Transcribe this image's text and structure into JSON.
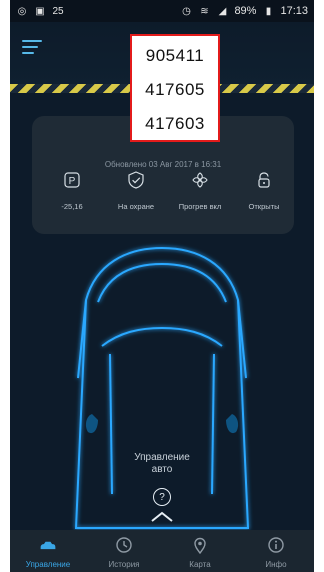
{
  "statusbar": {
    "left_icons": [
      "whatsapp-icon",
      "phone-icon",
      "25-icon"
    ],
    "battery": "89%",
    "time": "17:13"
  },
  "codes": [
    "905411",
    "417605",
    "417603"
  ],
  "card": {
    "updated": "Обновлено 03 Авг 2017 в 16:31",
    "stats": [
      {
        "label": "-25,16",
        "icon": "p-icon"
      },
      {
        "label": "На охране",
        "icon": "shield-check-icon"
      },
      {
        "label": "Прогрев вкл",
        "icon": "fan-icon"
      },
      {
        "label": "Открыты",
        "icon": "unlock-icon"
      }
    ]
  },
  "control": {
    "line1": "Управление",
    "line2": "авто"
  },
  "nav": [
    {
      "label": "Управление",
      "icon": "car-icon",
      "active": true
    },
    {
      "label": "История",
      "icon": "history-icon",
      "active": false
    },
    {
      "label": "Карта",
      "icon": "map-pin-icon",
      "active": false
    },
    {
      "label": "Инфо",
      "icon": "info-icon",
      "active": false
    }
  ],
  "colors": {
    "accent": "#3aa6e6",
    "stripe": "#e2d24a",
    "highlight": "#e31b1b"
  }
}
